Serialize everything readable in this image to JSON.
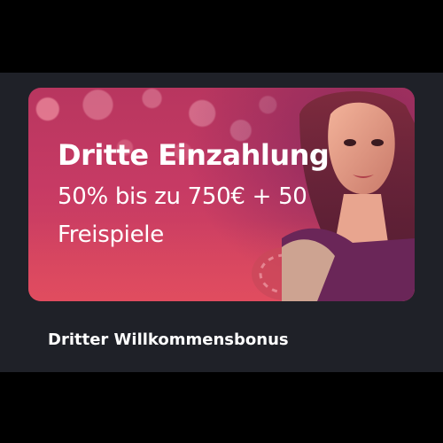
{
  "promo": {
    "title": "Dritte Einzahlung",
    "subtitle": "50% bis zu 750€ + 50 Freispiele",
    "caption": "Dritter Willkommensbonus"
  },
  "colors": {
    "page_background": "#000000",
    "card_background": "#1f2128",
    "banner_gradient_top": "#b8365f",
    "banner_gradient_bottom": "#d9485f",
    "text": "#ffffff"
  },
  "icons": {
    "banner_art": "woman-with-casino-chips-illustration"
  }
}
